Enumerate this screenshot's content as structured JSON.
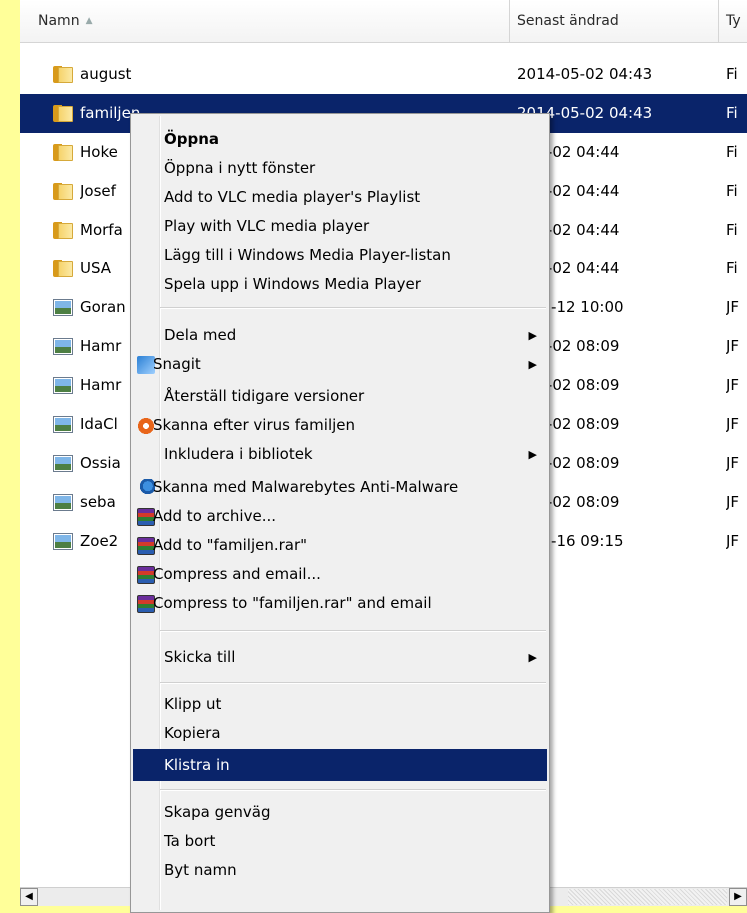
{
  "header": {
    "col_name": "Namn",
    "col_modified": "Senast ändrad",
    "col_type": "Ty"
  },
  "files": [
    {
      "name": "august",
      "modified": "2014-05-02 04:43",
      "type": "Fi",
      "icon": "folder-icon"
    },
    {
      "name": "familjen",
      "modified": "2014-05-02 04:43",
      "type": "Fi",
      "icon": "folder-icon"
    },
    {
      "name": "Hoke",
      "modified": "--05-02 04:44",
      "type": "Fi",
      "icon": "folder-icon"
    },
    {
      "name": "Josef",
      "modified": "--05-02 04:44",
      "type": "Fi",
      "icon": "folder-icon"
    },
    {
      "name": "Morfa",
      "modified": "--05-02 04:44",
      "type": "Fi",
      "icon": "folder-icon"
    },
    {
      "name": "USA",
      "modified": "--05-02 04:44",
      "type": "Fi",
      "icon": "folder-icon"
    },
    {
      "name": "Goran",
      "modified": "3-02-12 10:00",
      "type": "JF",
      "icon": "image-icon"
    },
    {
      "name": "Hamr",
      "modified": "--09-02 08:09",
      "type": "JF",
      "icon": "image-icon"
    },
    {
      "name": "Hamr",
      "modified": "--09-02 08:09",
      "type": "JF",
      "icon": "image-icon"
    },
    {
      "name": "IdaCl",
      "modified": "--09-02 08:09",
      "type": "JF",
      "icon": "image-icon"
    },
    {
      "name": "Ossia",
      "modified": "--09-02 08:09",
      "type": "JF",
      "icon": "image-icon"
    },
    {
      "name": "seba",
      "modified": "--09-02 08:09",
      "type": "JF",
      "icon": "image-icon"
    },
    {
      "name": "Zoe2",
      "modified": "5-02-16 09:15",
      "type": "JF",
      "icon": "image-icon"
    }
  ],
  "context_menu": {
    "open": "Öppna",
    "open_new_window": "Öppna i nytt fönster",
    "vlc_add": "Add to VLC media player's Playlist",
    "vlc_play": "Play with VLC media player",
    "wmp_add": "Lägg till i Windows Media Player-listan",
    "wmp_play": "Spela upp i Windows Media Player",
    "share_with": "Dela med",
    "snagit": "Snagit",
    "restore_versions": "Återställ tidigare versioner",
    "scan_virus": "Skanna efter virus familjen",
    "include_library": "Inkludera i bibliotek",
    "scan_malwarebytes": "Skanna med Malwarebytes Anti-Malware",
    "add_archive": "Add to archive...",
    "add_rar": "Add to \"familjen.rar\"",
    "compress_email": "Compress and email...",
    "compress_rar_email": "Compress to \"familjen.rar\" and email",
    "send_to": "Skicka till",
    "cut": "Klipp ut",
    "copy": "Kopiera",
    "paste": "Klistra in",
    "create_shortcut": "Skapa genväg",
    "delete": "Ta bort",
    "rename": "Byt namn",
    "submenu_arrow": "▶"
  },
  "colors": {
    "page_background": "#ffff99",
    "selection": "#0a246a",
    "menu_background": "#f0f0f0"
  }
}
